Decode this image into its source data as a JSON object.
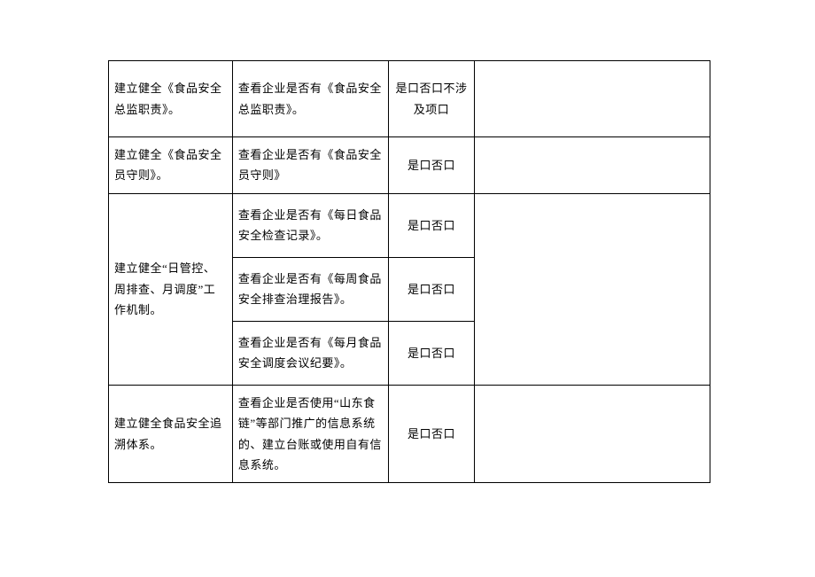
{
  "rows": [
    {
      "c1": "建立健全《食品安全总监职责》。",
      "c2": "查看企业是否有《食品安全总监职责》。",
      "c3": "是口否口不涉及项口",
      "c4": ""
    },
    {
      "c1": "建立健全《食品安全员守则》。",
      "c2": "查看企业是否有《食品安全员守则》",
      "c3": "是口否口",
      "c4": ""
    },
    {
      "c1": "建立健全“日管控、周排查、月调度”工作机制。",
      "c2a": "查看企业是否有《每日食品安全检查记录》。",
      "c3a": "是口否口",
      "c2b": "查看企业是否有《每周食品安全排查治理报告》。",
      "c3b": "是口否口",
      "c2c": "查看企业是否有《每月食品安全调度会议纪要》。",
      "c3c": "是口否口",
      "c4": ""
    },
    {
      "c1": "建立健全食品安全追溯体系。",
      "c2": "查看企业是否使用“山东食链”等部门推广的信息系统的、建立台账或使用自有信息系统。",
      "c3": "是口否口",
      "c4": ""
    }
  ]
}
